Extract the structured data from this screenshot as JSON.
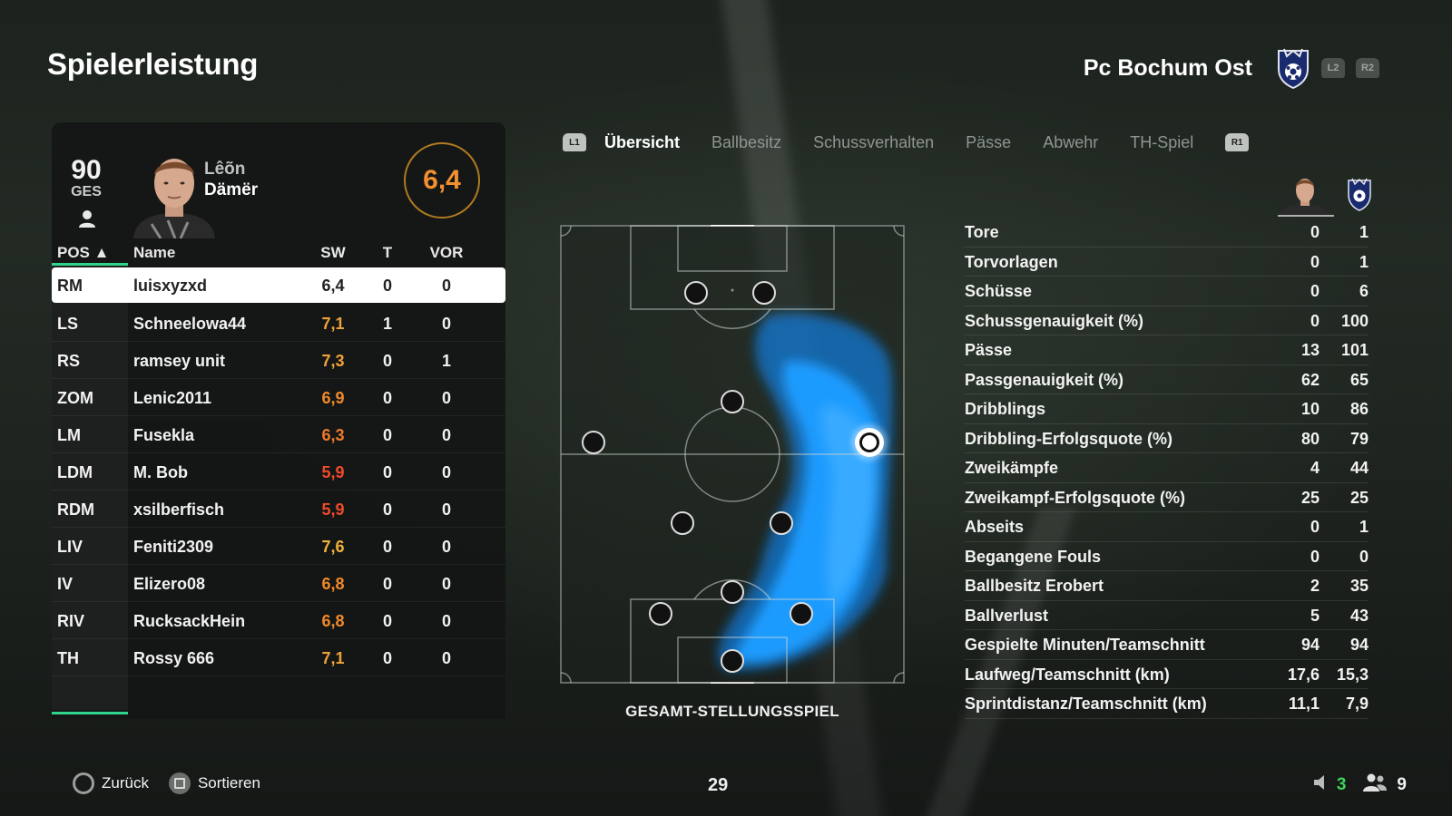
{
  "header": {
    "title": "Spielerleistung",
    "team_name": "Pc Bochum Ost",
    "btn_l2": "L2",
    "btn_r2": "R2"
  },
  "player_card": {
    "overall": "90",
    "overall_label": "GES",
    "first_name": "Lêõn",
    "last_name": "Dämër",
    "rating": "6,4"
  },
  "roster": {
    "headers": {
      "pos": "POS ▲",
      "name": "Name",
      "sw": "SW",
      "t": "T",
      "vor": "VOR"
    },
    "rows": [
      {
        "pos": "RM",
        "name": "luisxyzxd",
        "sw": "6,4",
        "t": "0",
        "vor": "0",
        "color": "#222222"
      },
      {
        "pos": "LS",
        "name": "Schneelowa44",
        "sw": "7,1",
        "t": "1",
        "vor": "0",
        "color": "#f0a23a"
      },
      {
        "pos": "RS",
        "name": "ramsey unit",
        "sw": "7,3",
        "t": "0",
        "vor": "1",
        "color": "#f0a23a"
      },
      {
        "pos": "ZOM",
        "name": "Lenic2011",
        "sw": "6,9",
        "t": "0",
        "vor": "0",
        "color": "#f08a2a"
      },
      {
        "pos": "LM",
        "name": "Fusekla",
        "sw": "6,3",
        "t": "0",
        "vor": "0",
        "color": "#f07a2a"
      },
      {
        "pos": "LDM",
        "name": "M. Bob",
        "sw": "5,9",
        "t": "0",
        "vor": "0",
        "color": "#f04a2a"
      },
      {
        "pos": "RDM",
        "name": "xsilberfisch",
        "sw": "5,9",
        "t": "0",
        "vor": "0",
        "color": "#f04a2a"
      },
      {
        "pos": "LIV",
        "name": "Feniti2309",
        "sw": "7,6",
        "t": "0",
        "vor": "0",
        "color": "#f0b23a"
      },
      {
        "pos": "IV",
        "name": "Elizero08",
        "sw": "6,8",
        "t": "0",
        "vor": "0",
        "color": "#f08a2a"
      },
      {
        "pos": "RIV",
        "name": "RucksackHein",
        "sw": "6,8",
        "t": "0",
        "vor": "0",
        "color": "#f08a2a"
      },
      {
        "pos": "TH",
        "name": "Rossy 666",
        "sw": "7,1",
        "t": "0",
        "vor": "0",
        "color": "#f0a23a"
      }
    ]
  },
  "tabs": {
    "left_chip": "L1",
    "right_chip": "R1",
    "items": [
      "Übersicht",
      "Ballbesitz",
      "Schussverhalten",
      "Pässe",
      "Abwehr",
      "TH-Spiel"
    ],
    "active": "Übersicht"
  },
  "pitch": {
    "caption": "GESAMT-STELLUNGSSPIEL",
    "heat_color": "#1e9bff"
  },
  "stats": [
    {
      "label": "Tore",
      "player": "0",
      "team": "1"
    },
    {
      "label": "Torvorlagen",
      "player": "0",
      "team": "1"
    },
    {
      "label": "Schüsse",
      "player": "0",
      "team": "6"
    },
    {
      "label": "Schussgenauigkeit (%)",
      "player": "0",
      "team": "100"
    },
    {
      "label": "Pässe",
      "player": "13",
      "team": "101"
    },
    {
      "label": "Passgenauigkeit (%)",
      "player": "62",
      "team": "65"
    },
    {
      "label": "Dribblings",
      "player": "10",
      "team": "86"
    },
    {
      "label": "Dribbling-Erfolgsquote (%)",
      "player": "80",
      "team": "79"
    },
    {
      "label": "Zweikämpfe",
      "player": "4",
      "team": "44"
    },
    {
      "label": "Zweikampf-Erfolgsquote (%)",
      "player": "25",
      "team": "25"
    },
    {
      "label": "Abseits",
      "player": "0",
      "team": "1"
    },
    {
      "label": "Begangene Fouls",
      "player": "0",
      "team": "0"
    },
    {
      "label": "Ballbesitz Erobert",
      "player": "2",
      "team": "35"
    },
    {
      "label": "Ballverlust",
      "player": "5",
      "team": "43"
    },
    {
      "label": "Gespielte Minuten/Teamschnitt",
      "player": "94",
      "team": "94"
    },
    {
      "label": "Laufweg/Teamschnitt (km)",
      "player": "17,6",
      "team": "15,3"
    },
    {
      "label": "Sprintdistanz/Teamschnitt (km)",
      "player": "11,1",
      "team": "7,9"
    }
  ],
  "footer": {
    "back_label": "Zurück",
    "sort_label": "Sortieren",
    "center_number": "29",
    "right_count_1": "3",
    "right_count_2": "9"
  },
  "colors": {
    "accent_green": "#2fd38a",
    "rating_orange": "#f09030"
  }
}
